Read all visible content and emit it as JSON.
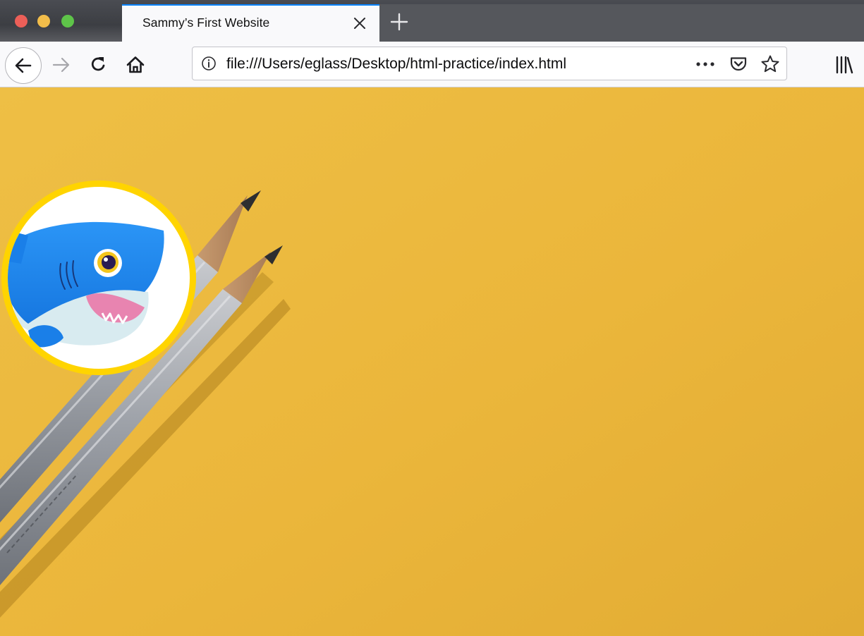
{
  "window": {
    "traffic_lights": [
      "close",
      "minimize",
      "maximize"
    ]
  },
  "tab": {
    "title": "Sammy’s First Website",
    "close_icon": "close-icon"
  },
  "new_tab_icon": "plus-icon",
  "toolbar": {
    "back_icon": "arrow-left-icon",
    "forward_icon": "arrow-right-icon",
    "reload_icon": "reload-icon",
    "home_icon": "home-icon",
    "site_info_icon": "info-icon",
    "url": "file:///Users/eglass/Desktop/html-practice/index.html",
    "page_actions_icon": "ellipsis-icon",
    "pocket_icon": "pocket-icon",
    "bookmark_icon": "star-icon",
    "library_icon": "library-icon"
  },
  "colors": {
    "accent": "#0a84ff",
    "page_background": "#eab53c",
    "shark_ring": "#ffd200",
    "shark_body": "#1e88f0"
  }
}
